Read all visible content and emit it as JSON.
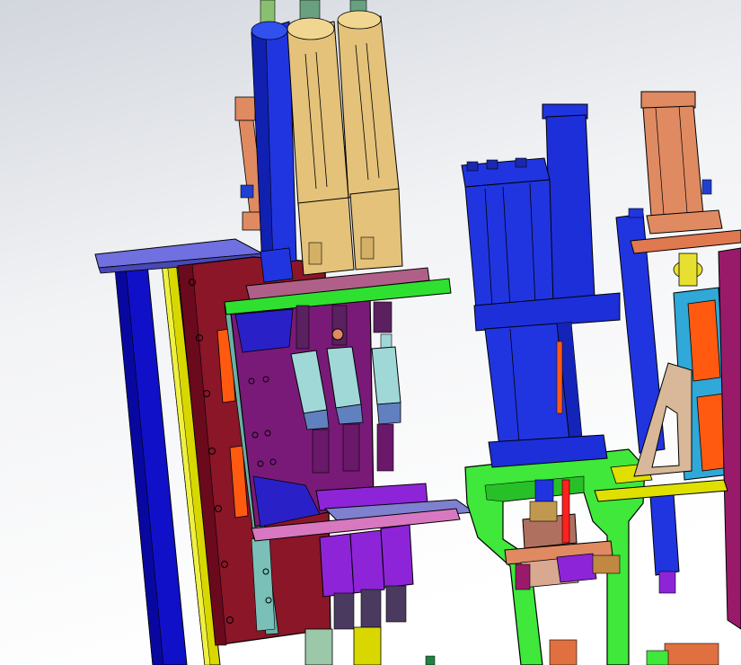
{
  "viewport": {
    "background_top": "#d2d6dd",
    "background_bottom": "#ffffff"
  },
  "model": {
    "components": [
      "left-pillar",
      "yellow-guide-rail",
      "top-mounting-plate",
      "maroon-back-plate",
      "purple-carriage",
      "dual-servo-motors",
      "spindle-assembly",
      "center-pneumatic-cylinder",
      "right-copper-cylinder",
      "green-base-frame",
      "right-side-panel"
    ],
    "colors": {
      "pillar_blue": "#1010c8",
      "motor_blue": "#2035e0",
      "rail_yellow": "#d8d800",
      "maroon": "#8a1628",
      "purple": "#7a1a78",
      "violet": "#8e24d8",
      "pink": "#d878c0",
      "tan_motor": "#e4c27a",
      "green": "#3fe83a",
      "copper": "#e08a62",
      "orange": "#ff5a10",
      "light_cyan": "#a0d8d8",
      "plate_periwinkle": "#7070e0",
      "beige": "#d8b898"
    }
  }
}
